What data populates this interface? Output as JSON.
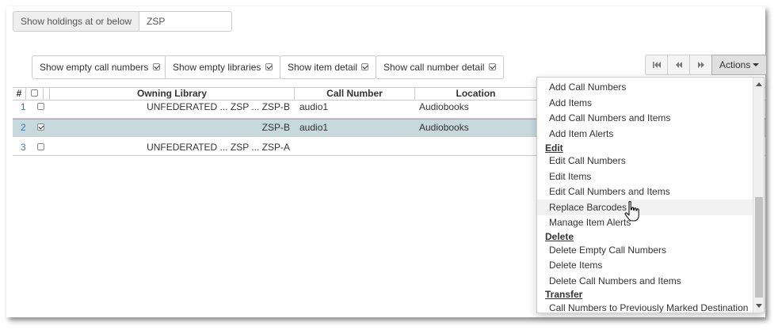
{
  "holdings_filter": {
    "label": "Show holdings at or below",
    "value": "ZSP"
  },
  "toggles": [
    {
      "label": "Show empty call numbers",
      "checked": true
    },
    {
      "label": "Show empty libraries",
      "checked": true
    },
    {
      "label": "Show item detail",
      "checked": true
    },
    {
      "label": "Show call number detail",
      "checked": true
    }
  ],
  "pager": {
    "first_icon": "first-page-icon",
    "prev_icon": "prev-page-icon",
    "next_icon": "next-page-icon"
  },
  "actions": {
    "label": "Actions"
  },
  "grid": {
    "headers": {
      "num": "#",
      "owning_library": "Owning Library",
      "call_number": "Call Number",
      "location": "Location"
    },
    "rows": [
      {
        "num": "1",
        "checked": false,
        "selected": false,
        "library": "UNFEDERATED ... ZSP ... ZSP-B",
        "call_number": "audio1",
        "location": "Audiobooks"
      },
      {
        "num": "2",
        "checked": true,
        "selected": true,
        "library": "ZSP-B",
        "call_number": "audio1",
        "location": "Audiobooks"
      },
      {
        "num": "3",
        "checked": false,
        "selected": false,
        "library": "UNFEDERATED ... ZSP ... ZSP-A",
        "call_number": "",
        "location": ""
      }
    ]
  },
  "menu": {
    "add": [
      "Add Call Numbers",
      "Add Items",
      "Add Call Numbers and Items",
      "Add Item Alerts"
    ],
    "edit_header": "Edit",
    "edit": [
      "Edit Call Numbers",
      "Edit Items",
      "Edit Call Numbers and Items",
      "Replace Barcodes",
      "Manage Item Alerts"
    ],
    "delete_header": "Delete",
    "delete": [
      "Delete Empty Call Numbers",
      "Delete Items",
      "Delete Call Numbers and Items"
    ],
    "transfer_header": "Transfer",
    "transfer": [
      "Call Numbers to Previously Marked Destination"
    ]
  }
}
